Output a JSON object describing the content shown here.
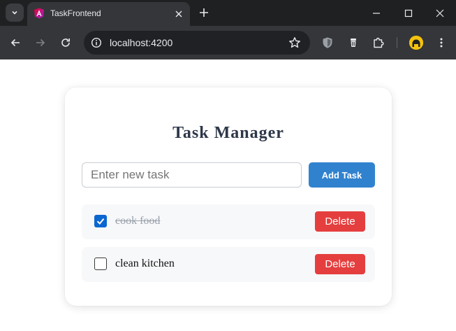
{
  "browser": {
    "tab": {
      "title": "TaskFrontend",
      "favicon": "angular-logo-icon"
    },
    "address_bar": {
      "url": "localhost:4200"
    },
    "icons": [
      "tab-search-icon",
      "close-icon",
      "plus-icon",
      "minimize-icon",
      "maximize-icon",
      "close-icon",
      "back-arrow-icon",
      "forward-arrow-icon",
      "reload-icon",
      "site-info-icon",
      "star-icon",
      "shield-extension-icon",
      "cup-extension-icon",
      "puzzle-icon",
      "profile-avatar-icon",
      "kebab-menu-icon"
    ],
    "colors": {
      "frame": "#1f2022",
      "toolbar": "#35363a",
      "omnibox": "#202124"
    }
  },
  "app": {
    "title": "Task Manager",
    "input": {
      "placeholder": "Enter new task",
      "value": ""
    },
    "add_button": "Add Task",
    "tasks": [
      {
        "text": "cook food",
        "completed": true,
        "delete_label": "Delete"
      },
      {
        "text": "clean kitchen",
        "completed": false,
        "delete_label": "Delete"
      }
    ],
    "colors": {
      "title": "#2d3748",
      "add_button": "#3182ce",
      "delete_button": "#e53e3e",
      "checkbox_checked": "#0b67d0"
    }
  }
}
